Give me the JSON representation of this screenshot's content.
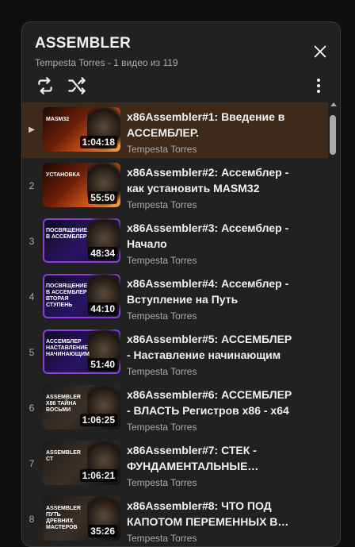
{
  "playlist": {
    "title": "ASSEMBLER",
    "subtitle": "Tempesta Torres - 1 видео из 119"
  },
  "icons": {
    "close": "close-icon",
    "loop": "loop-icon",
    "shuffle": "shuffle-icon",
    "more": "more-vert-icon",
    "now_playing": "play-indicator-icon"
  },
  "colors": {
    "active_row": "#3d2a1a",
    "panel": "#212121",
    "background": "#0f0f0f"
  },
  "items": [
    {
      "index": "▶",
      "title": "x86Assembler#1: Введение в\nАССЕМБЛЕР.",
      "channel": "Tempesta Torres",
      "duration": "1:04:18",
      "thumb_text": "MASM32",
      "theme": "fire"
    },
    {
      "index": "2",
      "title": "x86Assembler#2: Ассемблер -\nкак установить MASM32",
      "channel": "Tempesta Torres",
      "duration": "55:50",
      "thumb_text": "УСТАНОВКА",
      "theme": "fire"
    },
    {
      "index": "3",
      "title": "x86Assembler#3: Ассемблер -\nНачало",
      "channel": "Tempesta Torres",
      "duration": "48:34",
      "thumb_text": "ПОСВЯЩЕНИЕ В АССЕМБЛЕР",
      "theme": "purple"
    },
    {
      "index": "4",
      "title": "x86Assembler#4: Ассемблер -\nВступление на Путь",
      "channel": "Tempesta Torres",
      "duration": "44:10",
      "thumb_text": "ПОСВЯЩЕНИЕ В АССЕМБЛЕР ВТОРАЯ СТУПЕНЬ",
      "theme": "purple"
    },
    {
      "index": "5",
      "title": "x86Assembler#5: АССЕМБЛЕР\n- Наставление начинающим",
      "channel": "Tempesta Torres",
      "duration": "51:40",
      "thumb_text": "АССЕМБЛЕР НАСТАВЛЕНИЕ НАЧИНАЮЩИМ",
      "theme": "purple"
    },
    {
      "index": "6",
      "title": "x86Assembler#6: АССЕМБЛЕР\n- ВЛАСТЬ Регистров x86 - x64",
      "channel": "Tempesta Torres",
      "duration": "1:06:25",
      "thumb_text": "ASSEMBLER x86 ТАЙНА ВОСЬМИ",
      "theme": "dark"
    },
    {
      "index": "7",
      "title": "x86Assembler#7: СТЕК -\nФУНДАМЕНТАЛЬНЫЕ…",
      "channel": "Tempesta Torres",
      "duration": "1:06:21",
      "thumb_text": "ASSEMBLER СТ",
      "theme": "dark"
    },
    {
      "index": "8",
      "title": "x86Assembler#8: ЧТО ПОД\nКАПОТОМ ПЕРЕМЕННЫХ В…",
      "channel": "Tempesta Torres",
      "duration": "35:26",
      "thumb_text": "ASSEMBLER ПУТЬ ДРЕВНИХ МАСТЕРОВ",
      "theme": "dark"
    }
  ]
}
